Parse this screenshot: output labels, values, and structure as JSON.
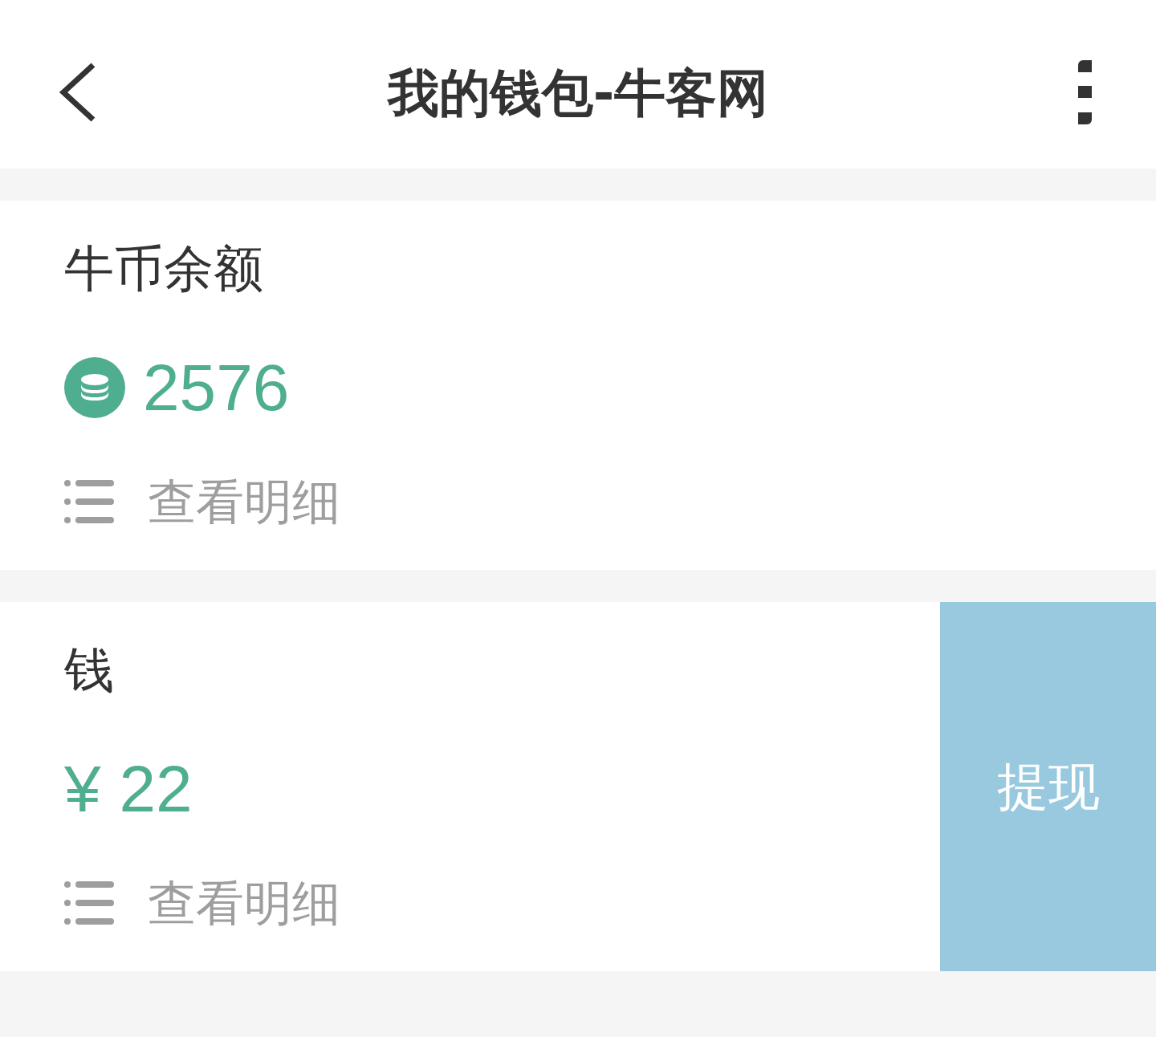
{
  "header": {
    "title": "我的钱包-牛客网"
  },
  "cards": [
    {
      "kind": "coins",
      "label": "牛币余额",
      "amount": "2576",
      "details_link": "查看明细"
    },
    {
      "kind": "cash",
      "label": "钱",
      "amount": "¥ 22",
      "details_link": "查看明细",
      "action_button": "提现"
    }
  ]
}
